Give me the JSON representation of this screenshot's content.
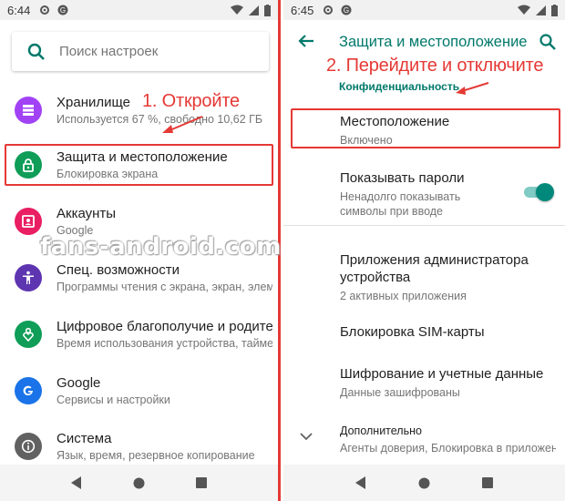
{
  "left": {
    "status": {
      "time": "6:44"
    },
    "search": {
      "placeholder": "Поиск настроек"
    },
    "items": [
      {
        "title": "Хранилище",
        "sub": "Используется 67 %, свободно 10,62 ГБ",
        "color": "#a142f4",
        "icon": "storage-icon"
      },
      {
        "title": "Защита и местоположение",
        "sub": "Блокировка экрана",
        "color": "#0f9d58",
        "icon": "lock-icon"
      },
      {
        "title": "Аккаунты",
        "sub": "Google",
        "color": "#e91e63",
        "icon": "account-icon"
      },
      {
        "title": "Спец. возможности",
        "sub": "Программы чтения с экрана, экран, элементы",
        "color": "#5e35b1",
        "icon": "accessibility-icon"
      },
      {
        "title": "Цифровое благополучие и родительский контроль",
        "sub": "Время использования устройства, таймеры",
        "color": "#0f9d58",
        "icon": "wellbeing-icon"
      },
      {
        "title": "Google",
        "sub": "Сервисы и настройки",
        "color": "#1a73e8",
        "icon": "google-icon"
      },
      {
        "title": "Система",
        "sub": "Язык, время, резервное копирование",
        "color": "#616161",
        "icon": "info-icon"
      }
    ],
    "annotation": "1. Откройте"
  },
  "right": {
    "status": {
      "time": "6:45"
    },
    "appbar_title": "Защита и местоположение",
    "section_header": "Конфиденциальность",
    "items": [
      {
        "title": "Местоположение",
        "sub": "Включено"
      },
      {
        "title": "Показывать пароли",
        "sub": "Ненадолго показывать символы при вводе",
        "toggle": true
      },
      {
        "title": "Приложения администратора устройства",
        "sub": "2 активных приложения"
      },
      {
        "title": "Блокировка SIM-карты",
        "sub": ""
      },
      {
        "title": "Шифрование и учетные данные",
        "sub": "Данные зашифрованы"
      },
      {
        "title": "Дополнительно",
        "sub": "Агенты доверия, Блокировка в приложении"
      }
    ],
    "annotation": "2. Перейдите и отключите"
  },
  "watermark": "fans-android.com",
  "colors": {
    "accent": "#00796b",
    "highlight": "#e53935",
    "toggle": "#00897b"
  }
}
